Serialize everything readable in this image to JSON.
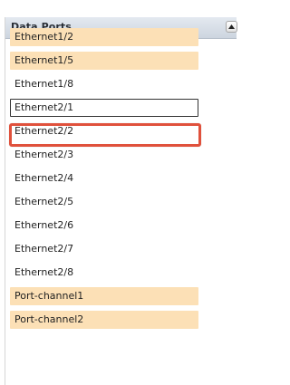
{
  "panel": {
    "title": "Data Ports",
    "collapse_icon": "triangle-up-icon"
  },
  "ports": [
    {
      "label": "Ethernet1/2",
      "selected": true
    },
    {
      "label": "Ethernet1/5",
      "selected": true
    },
    {
      "label": "Ethernet1/8",
      "selected": false
    },
    {
      "label": "Ethernet2/1",
      "selected": false,
      "highlighted": true
    },
    {
      "label": "Ethernet2/2",
      "selected": false
    },
    {
      "label": "Ethernet2/3",
      "selected": false
    },
    {
      "label": "Ethernet2/4",
      "selected": false
    },
    {
      "label": "Ethernet2/5",
      "selected": false
    },
    {
      "label": "Ethernet2/6",
      "selected": false
    },
    {
      "label": "Ethernet2/7",
      "selected": false
    },
    {
      "label": "Ethernet2/8",
      "selected": false
    },
    {
      "label": "Port-channel1",
      "selected": true
    },
    {
      "label": "Port-channel2",
      "selected": true
    }
  ],
  "colors": {
    "selected_bg": "#fce0b6",
    "annotation_border": "#e0513c"
  }
}
